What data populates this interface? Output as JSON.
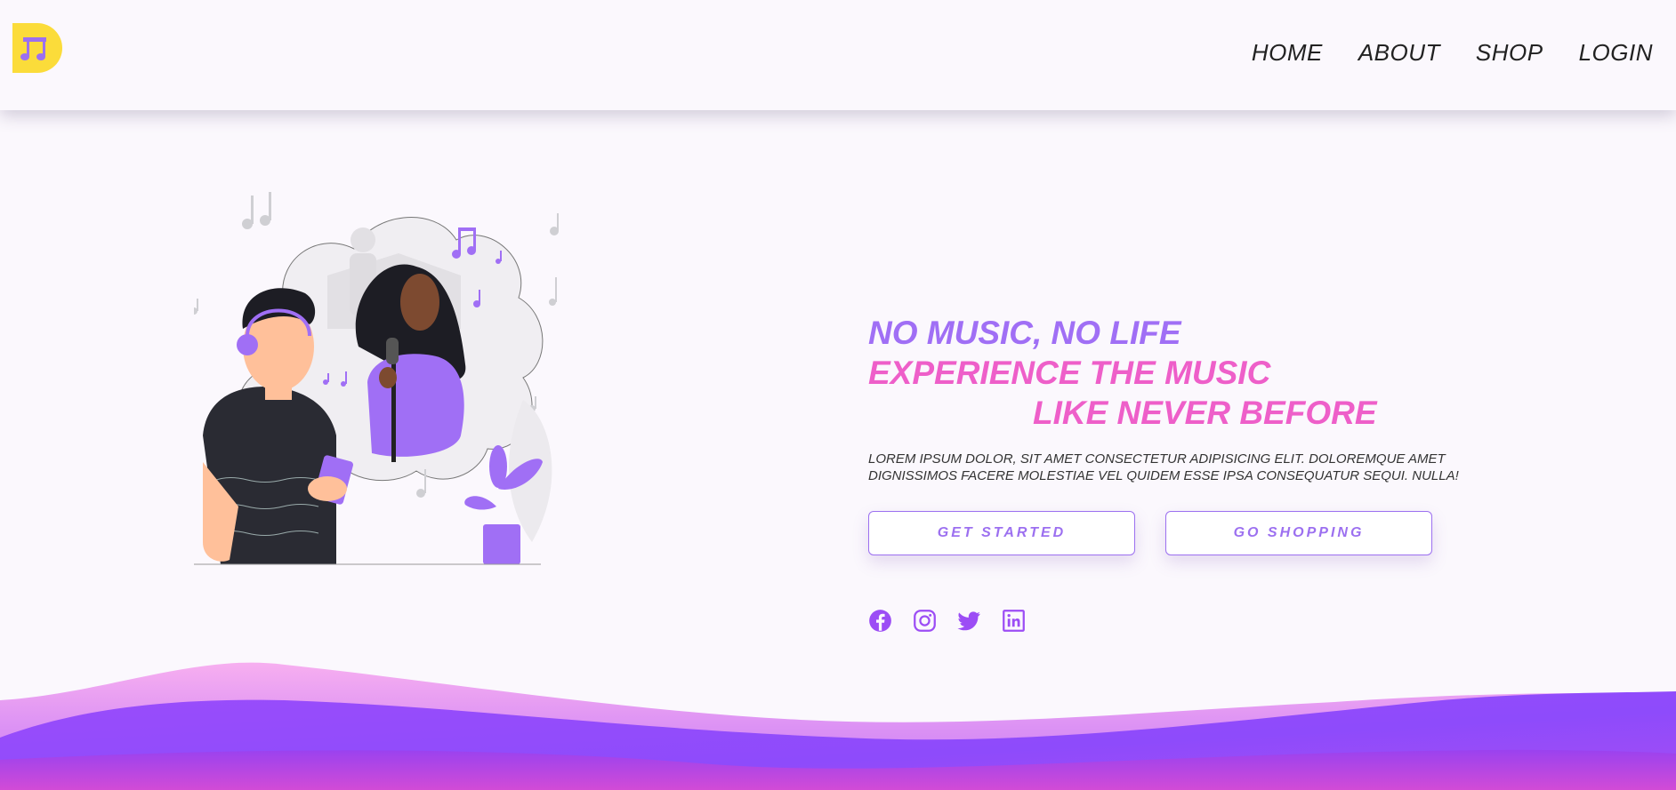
{
  "header": {
    "logo_icon": "music-note-icon",
    "nav": [
      {
        "label": "HOME"
      },
      {
        "label": "ABOUT"
      },
      {
        "label": "SHOP"
      },
      {
        "label": "LOGIN"
      }
    ]
  },
  "hero": {
    "line1": "NO MUSIC, NO LIFE",
    "line2": "EXPERIENCE THE MUSIC",
    "line3": "LIKE NEVER BEFORE",
    "description": "LOREM IPSUM DOLOR, SIT AMET CONSECTETUR ADIPISICING ELIT. DOLOREMQUE AMET DIGNISSIMOS FACERE MOLESTIAE VEL QUIDEM ESSE IPSA CONSEQUATUR SEQUI. NULLA!",
    "primary_button": "GET STARTED",
    "secondary_button": "GO SHOPPING",
    "socials": [
      "facebook-icon",
      "instagram-icon",
      "twitter-icon",
      "linkedin-icon"
    ]
  },
  "colors": {
    "accent_purple": "#a06ff5",
    "accent_pink": "#ee5fc9",
    "logo_yellow": "#fbdc3a",
    "wave_top": "#f4a6e9",
    "wave_bottom": "#8a44fb"
  }
}
